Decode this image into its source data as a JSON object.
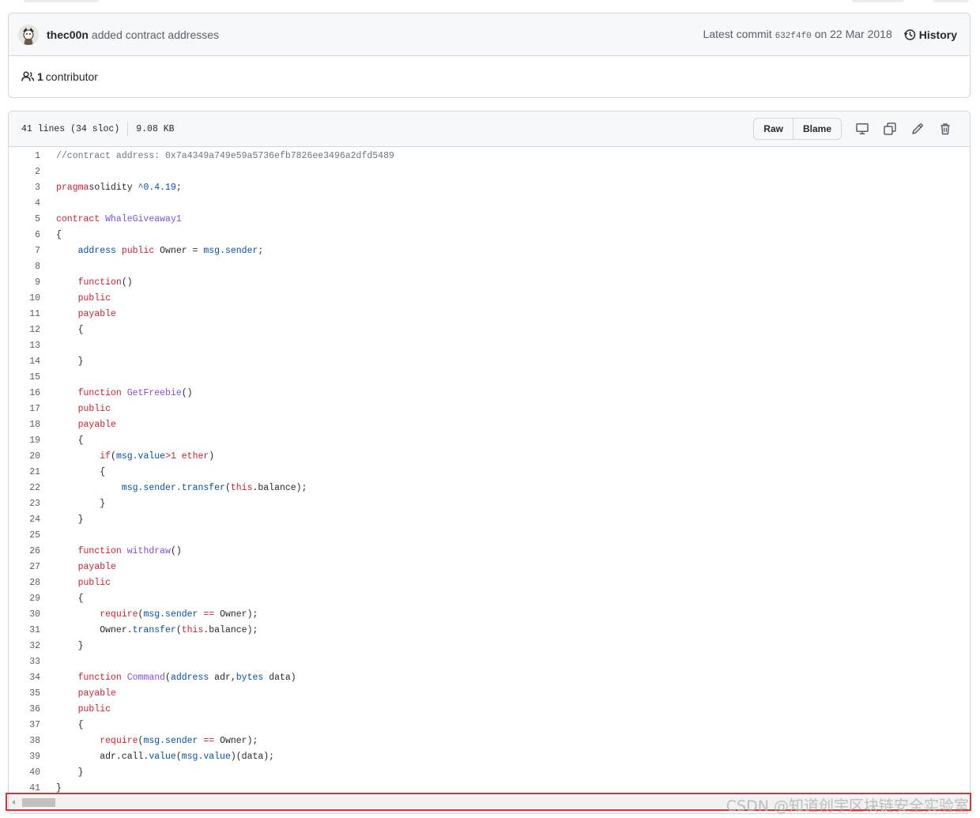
{
  "commit": {
    "author": "thec00n",
    "message": "added contract addresses",
    "latest_prefix": "Latest commit",
    "sha": "632f4f0",
    "date_text": "on 22 Mar 2018",
    "history_label": "History",
    "contributors_count": "1",
    "contributors_label": "contributor"
  },
  "file": {
    "lines_info": "41 lines (34 sloc)",
    "size": "9.08 KB",
    "raw_label": "Raw",
    "blame_label": "Blame",
    "icons": [
      "desktop-icon",
      "copy-icon",
      "pencil-icon",
      "trash-icon"
    ]
  },
  "code_lines": [
    [
      [
        "c",
        "//contract address: 0x7a4349a749e59a5736efb7826ee3496a2dfd5489"
      ]
    ],
    [],
    [
      [
        "k",
        "pragma"
      ],
      [
        "",
        "solidity "
      ],
      [
        "b",
        "^0.4.19"
      ],
      [
        "",
        ";"
      ]
    ],
    [],
    [
      [
        "k",
        "contract"
      ],
      [
        "",
        " "
      ],
      [
        "e",
        "WhaleGiveaway1"
      ]
    ],
    [
      [
        "",
        "{"
      ]
    ],
    [
      [
        "",
        "    "
      ],
      [
        "b",
        "address"
      ],
      [
        "",
        " "
      ],
      [
        "k",
        "public"
      ],
      [
        "",
        " Owner = "
      ],
      [
        "b",
        "msg.sender"
      ],
      [
        "",
        ";"
      ]
    ],
    [],
    [
      [
        "",
        "    "
      ],
      [
        "k",
        "function"
      ],
      [
        "",
        "()"
      ]
    ],
    [
      [
        "",
        "    "
      ],
      [
        "k",
        "public"
      ]
    ],
    [
      [
        "",
        "    "
      ],
      [
        "k",
        "payable"
      ]
    ],
    [
      [
        "",
        "    {"
      ]
    ],
    [],
    [
      [
        "",
        "    }"
      ]
    ],
    [],
    [
      [
        "",
        "    "
      ],
      [
        "k",
        "function"
      ],
      [
        "",
        " "
      ],
      [
        "e",
        "GetFreebie"
      ],
      [
        "",
        "()"
      ]
    ],
    [
      [
        "",
        "    "
      ],
      [
        "k",
        "public"
      ]
    ],
    [
      [
        "",
        "    "
      ],
      [
        "k",
        "payable"
      ]
    ],
    [
      [
        "",
        "    {"
      ]
    ],
    [
      [
        "",
        "        "
      ],
      [
        "k",
        "if"
      ],
      [
        "",
        "("
      ],
      [
        "b",
        "msg.value"
      ],
      [
        "k",
        ">1 ether"
      ],
      [
        "",
        ")"
      ]
    ],
    [
      [
        "",
        "        {"
      ]
    ],
    [
      [
        "",
        "            "
      ],
      [
        "b",
        "msg.sender.transfer"
      ],
      [
        "",
        "("
      ],
      [
        "k",
        "this"
      ],
      [
        "",
        ".balance);"
      ]
    ],
    [
      [
        "",
        "        }"
      ]
    ],
    [
      [
        "",
        "    }"
      ]
    ],
    [],
    [
      [
        "",
        "    "
      ],
      [
        "k",
        "function"
      ],
      [
        "",
        " "
      ],
      [
        "e",
        "withdraw"
      ],
      [
        "",
        "()"
      ]
    ],
    [
      [
        "",
        "    "
      ],
      [
        "k",
        "payable"
      ]
    ],
    [
      [
        "",
        "    "
      ],
      [
        "k",
        "public"
      ]
    ],
    [
      [
        "",
        "    {"
      ]
    ],
    [
      [
        "",
        "        "
      ],
      [
        "k",
        "require"
      ],
      [
        "",
        "("
      ],
      [
        "b",
        "msg.sender"
      ],
      [
        "",
        " "
      ],
      [
        "k",
        "=="
      ],
      [
        "",
        " Owner);"
      ]
    ],
    [
      [
        "",
        "        Owner."
      ],
      [
        "b",
        "transfer"
      ],
      [
        "",
        "("
      ],
      [
        "k",
        "this"
      ],
      [
        "",
        ".balance);"
      ]
    ],
    [
      [
        "",
        "    }"
      ]
    ],
    [],
    [
      [
        "",
        "    "
      ],
      [
        "k",
        "function"
      ],
      [
        "",
        " "
      ],
      [
        "e",
        "Command"
      ],
      [
        "",
        "("
      ],
      [
        "b",
        "address"
      ],
      [
        "",
        " adr,"
      ],
      [
        "b",
        "bytes"
      ],
      [
        "",
        " data)"
      ]
    ],
    [
      [
        "",
        "    "
      ],
      [
        "k",
        "payable"
      ]
    ],
    [
      [
        "",
        "    "
      ],
      [
        "k",
        "public"
      ]
    ],
    [
      [
        "",
        "    {"
      ]
    ],
    [
      [
        "",
        "        "
      ],
      [
        "k",
        "require"
      ],
      [
        "",
        "("
      ],
      [
        "b",
        "msg.sender"
      ],
      [
        "",
        " "
      ],
      [
        "k",
        "=="
      ],
      [
        "",
        " Owner);"
      ]
    ],
    [
      [
        "",
        "        adr.call."
      ],
      [
        "b",
        "value"
      ],
      [
        "",
        "("
      ],
      [
        "b",
        "msg.value"
      ],
      [
        "",
        ")(data);"
      ]
    ],
    [
      [
        "",
        "    }"
      ]
    ],
    [
      [
        "",
        "}"
      ]
    ]
  ],
  "watermark": "CSDN @知道创宇区块链安全实验室"
}
